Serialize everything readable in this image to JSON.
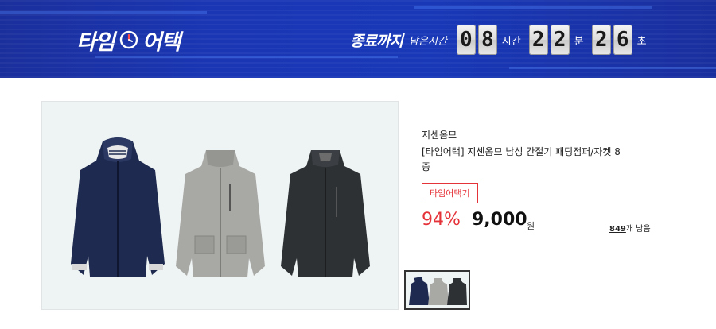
{
  "banner": {
    "logo_left": "타임",
    "logo_right": "어택",
    "countdown_title": "종료까지",
    "countdown_sub": "남은시간",
    "hours": [
      "0",
      "8"
    ],
    "hours_unit": "시간",
    "minutes": [
      "2",
      "2"
    ],
    "minutes_unit": "분",
    "seconds": [
      "2",
      "6"
    ],
    "seconds_unit": "초"
  },
  "product": {
    "brand": "지센옴므",
    "title": "[타임어택] 지센옴므 남성 간절기 패딩점퍼/자켓 8종",
    "tag": "타임어택기",
    "discount": "94%",
    "price": "9,000",
    "price_unit": "원",
    "stock_count": "849",
    "stock_suffix": "개 남음"
  },
  "colors": {
    "banner": "#1a36b4",
    "accent_red": "#e5333a",
    "navy_jacket": "#1e2a4f",
    "gray_jacket": "#a8a8a5",
    "black_jacket": "#2e3134"
  }
}
